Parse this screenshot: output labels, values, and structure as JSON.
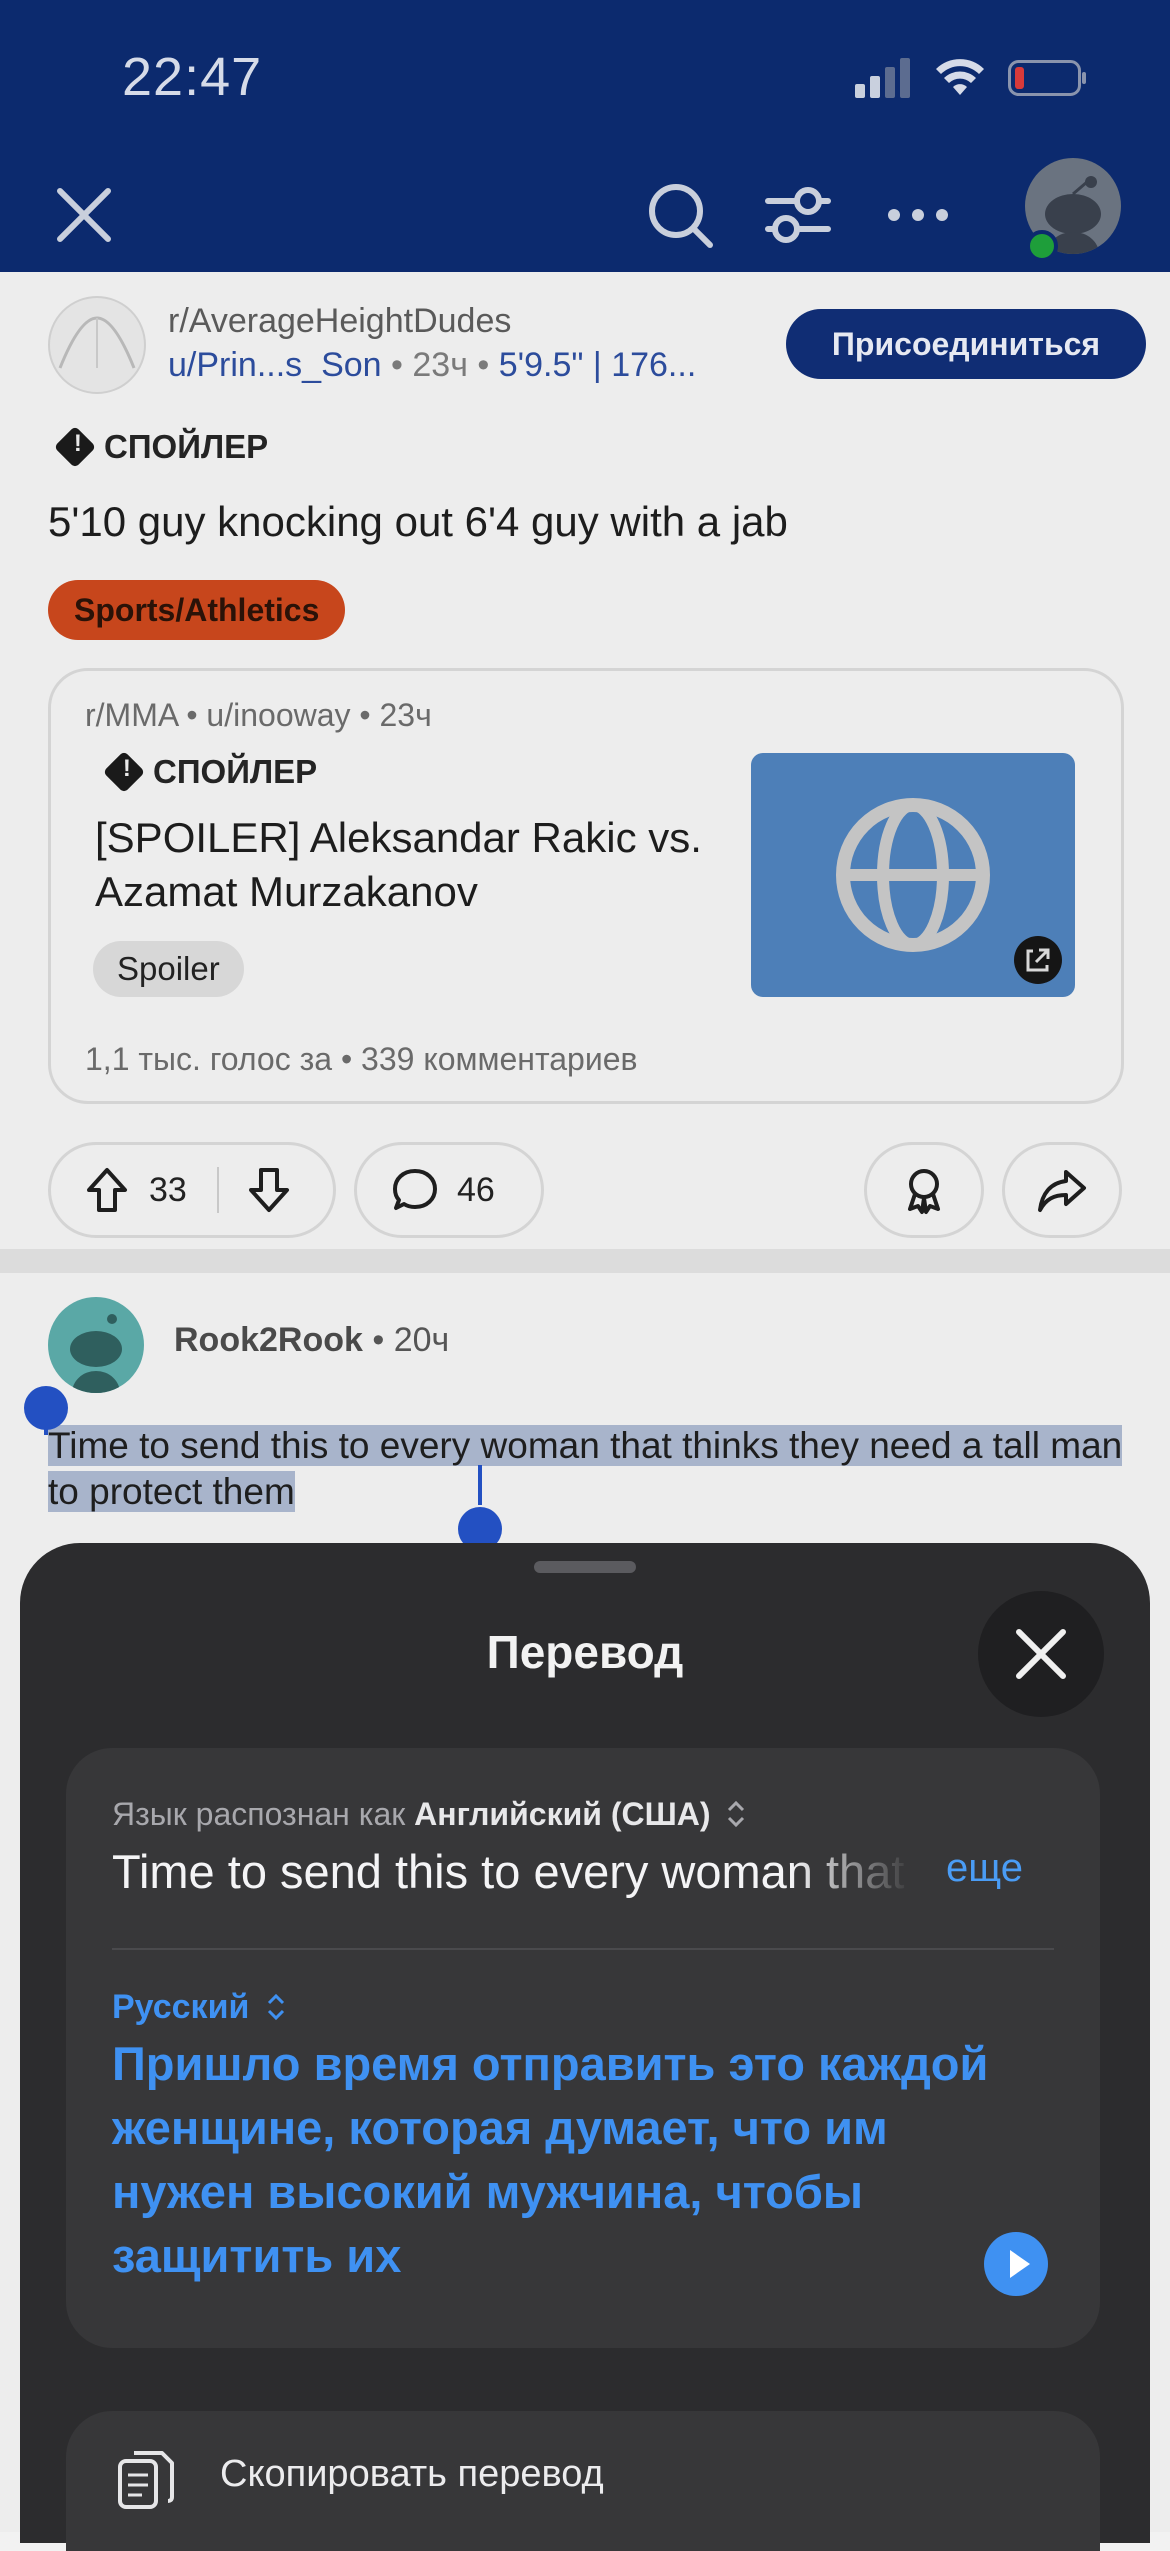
{
  "status": {
    "time": "22:47"
  },
  "header": {
    "icons": [
      "close-icon",
      "search-icon",
      "filter-icon",
      "more-icon",
      "avatar"
    ]
  },
  "post": {
    "subreddit": "r/AverageHeightDudes",
    "author": "u/Prin...s_Son",
    "age": "23ч",
    "user_flair": "5'9.5\" | 176...",
    "join_label": "Присоединиться",
    "spoiler_label": "СПОЙЛЕР",
    "title": "5'10 guy knocking out 6'4 guy with a jab",
    "flair": "Sports/Athletics",
    "crosspost": {
      "subreddit": "r/MMA",
      "author": "u/inooway",
      "age": "23ч",
      "spoiler_label": "СПОЙЛЕР",
      "title": "[SPOILER] Aleksandar Rakic vs. Azamat Murzakanov",
      "tag": "Spoiler",
      "stats": "1,1 тыс. голос за • 339 комментариев"
    },
    "votes": "33",
    "comments": "46"
  },
  "comment": {
    "username": "Rook2Rook",
    "age": "20ч",
    "text": "Time to send this to every woman that thinks they need a tall man to protect them"
  },
  "translate": {
    "title": "Перевод",
    "detected_prefix": "Язык распознан как",
    "detected_lang": "Английский (США)",
    "source_text": "Time to send this to every woman that thinks they need a tall man to protect them",
    "more_label": "еще",
    "target_lang": "Русский",
    "translated_text": "Пришло время отправить это каждой женщине, которая думает, что им нужен высокий мужчина, чтобы защитить их",
    "copy_label": "Скопировать перевод"
  },
  "colors": {
    "header": "#0c2a6e",
    "accent": "#3f91f2",
    "flair": "#c7461c"
  }
}
